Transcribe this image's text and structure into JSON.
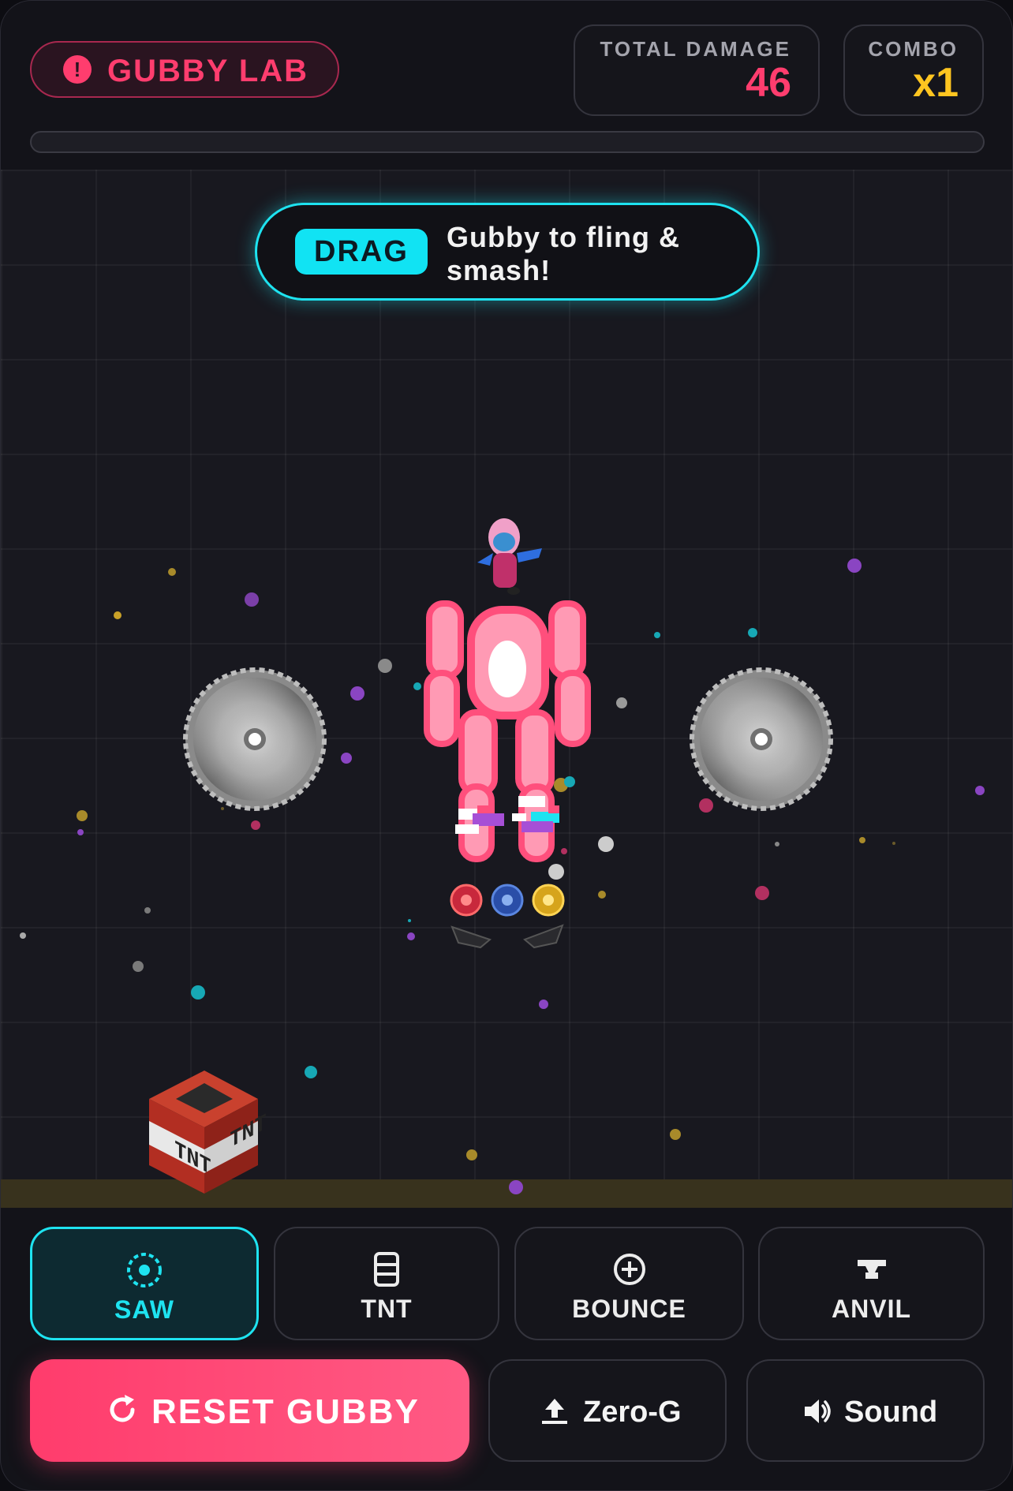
{
  "header": {
    "brand": "GUBBY LAB",
    "total_damage_label": "TOTAL DAMAGE",
    "total_damage_value": "46",
    "combo_label": "COMBO",
    "combo_value": "x1",
    "damage_progress": 0
  },
  "hint": {
    "badge": "DRAG",
    "message": "Gubby to fling & smash!"
  },
  "tools": [
    {
      "label": "SAW",
      "icon": "saw-icon",
      "selected": true
    },
    {
      "label": "TNT",
      "icon": "tnt-icon",
      "selected": false
    },
    {
      "label": "BOUNCE",
      "icon": "bounce-icon",
      "selected": false
    },
    {
      "label": "ANVIL",
      "icon": "anvil-icon",
      "selected": false
    }
  ],
  "actions": {
    "reset": "RESET GUBBY",
    "zero_g": "Zero-G",
    "sound": "Sound"
  },
  "arena": {
    "tnt_label": "TNT"
  },
  "colors": {
    "accent_pink": "#ff3d6e",
    "accent_cyan": "#1ee3f0",
    "accent_yellow": "#ffc520",
    "gubby_pink": "#ff5f88"
  }
}
